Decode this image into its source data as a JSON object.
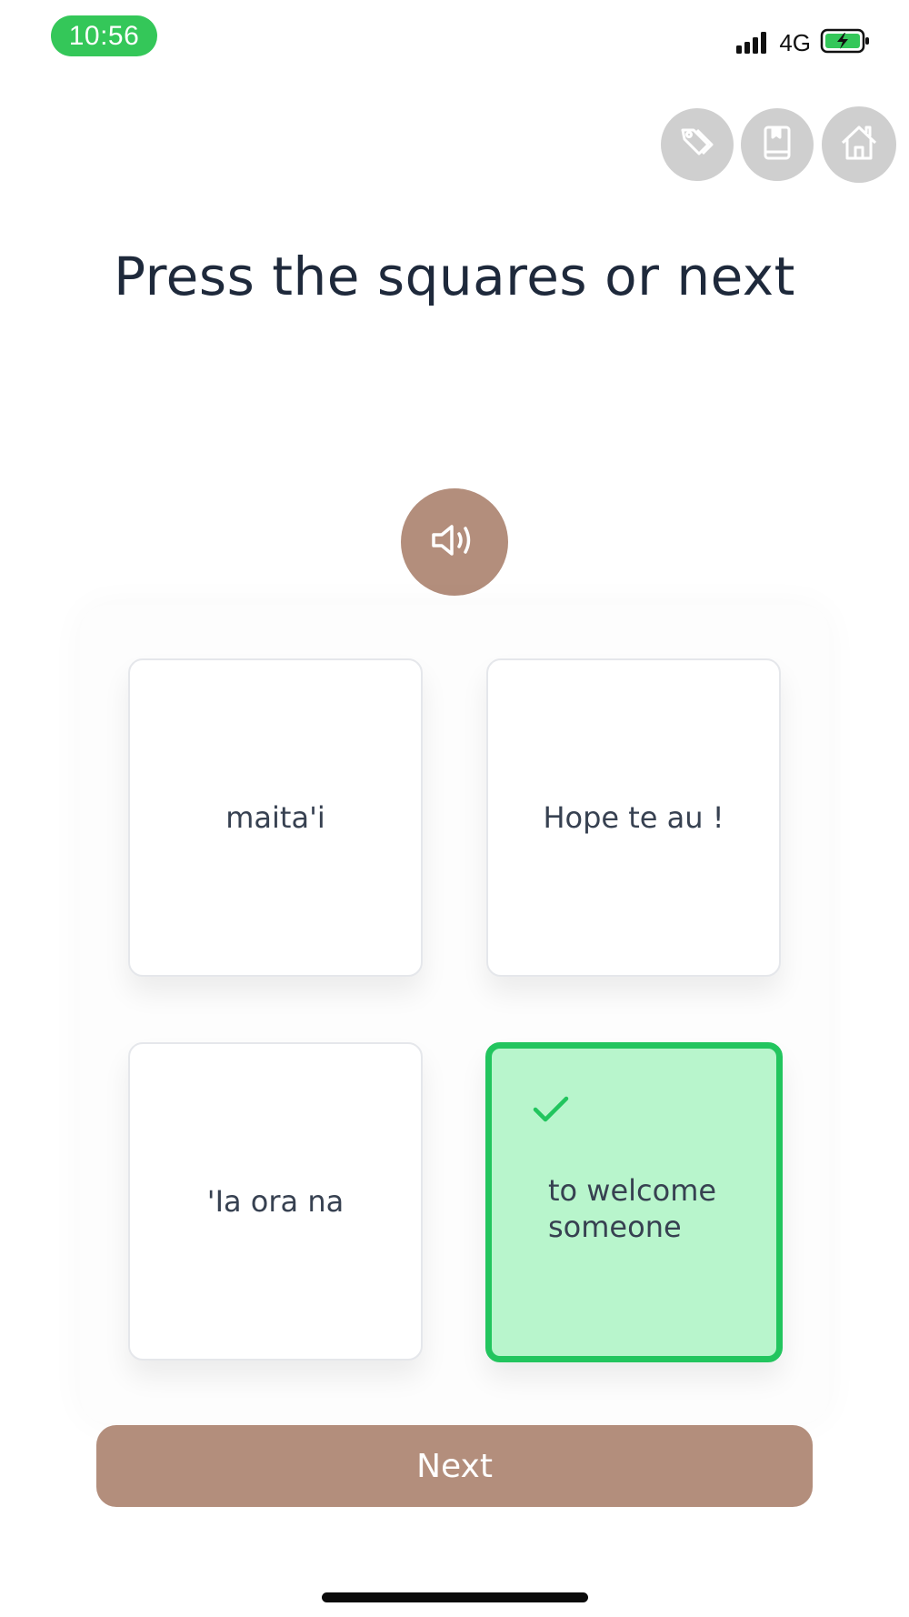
{
  "status_bar": {
    "time": "10:56",
    "network": "4G",
    "accent_color": "#34c759"
  },
  "toolbar": {
    "buttons": [
      {
        "icon": "tag-icon"
      },
      {
        "icon": "book-icon"
      },
      {
        "icon": "home-icon"
      }
    ]
  },
  "prompt": {
    "title": "Press the squares or next"
  },
  "audio": {
    "icon": "speaker-icon",
    "color": "#b38e7c"
  },
  "cards": [
    {
      "text": "maita'i",
      "selected": false
    },
    {
      "text": "Hope te au !",
      "selected": false
    },
    {
      "text": "'Ia ora na",
      "selected": false
    },
    {
      "text": "to welcome someone",
      "selected": true,
      "icon": "checkmark-icon"
    }
  ],
  "colors": {
    "selected_bg": "#b8f5cc",
    "selected_border": "#22c55e",
    "primary_button": "#b38e7c"
  },
  "footer": {
    "next_label": "Next"
  }
}
